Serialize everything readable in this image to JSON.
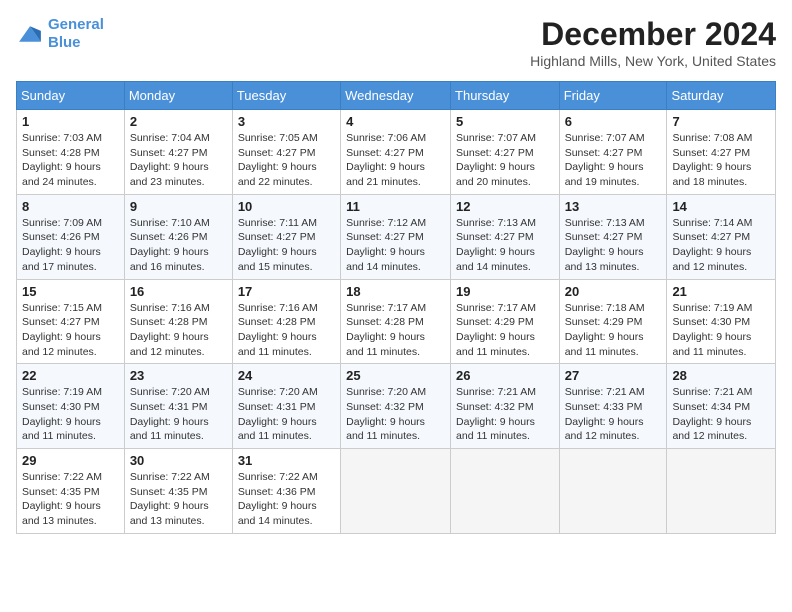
{
  "header": {
    "logo_line1": "General",
    "logo_line2": "Blue",
    "month": "December 2024",
    "location": "Highland Mills, New York, United States"
  },
  "days_of_week": [
    "Sunday",
    "Monday",
    "Tuesday",
    "Wednesday",
    "Thursday",
    "Friday",
    "Saturday"
  ],
  "weeks": [
    [
      {
        "num": "1",
        "sunrise": "7:03 AM",
        "sunset": "4:28 PM",
        "daylight": "9 hours and 24 minutes."
      },
      {
        "num": "2",
        "sunrise": "7:04 AM",
        "sunset": "4:27 PM",
        "daylight": "9 hours and 23 minutes."
      },
      {
        "num": "3",
        "sunrise": "7:05 AM",
        "sunset": "4:27 PM",
        "daylight": "9 hours and 22 minutes."
      },
      {
        "num": "4",
        "sunrise": "7:06 AM",
        "sunset": "4:27 PM",
        "daylight": "9 hours and 21 minutes."
      },
      {
        "num": "5",
        "sunrise": "7:07 AM",
        "sunset": "4:27 PM",
        "daylight": "9 hours and 20 minutes."
      },
      {
        "num": "6",
        "sunrise": "7:07 AM",
        "sunset": "4:27 PM",
        "daylight": "9 hours and 19 minutes."
      },
      {
        "num": "7",
        "sunrise": "7:08 AM",
        "sunset": "4:27 PM",
        "daylight": "9 hours and 18 minutes."
      }
    ],
    [
      {
        "num": "8",
        "sunrise": "7:09 AM",
        "sunset": "4:26 PM",
        "daylight": "9 hours and 17 minutes."
      },
      {
        "num": "9",
        "sunrise": "7:10 AM",
        "sunset": "4:26 PM",
        "daylight": "9 hours and 16 minutes."
      },
      {
        "num": "10",
        "sunrise": "7:11 AM",
        "sunset": "4:27 PM",
        "daylight": "9 hours and 15 minutes."
      },
      {
        "num": "11",
        "sunrise": "7:12 AM",
        "sunset": "4:27 PM",
        "daylight": "9 hours and 14 minutes."
      },
      {
        "num": "12",
        "sunrise": "7:13 AM",
        "sunset": "4:27 PM",
        "daylight": "9 hours and 14 minutes."
      },
      {
        "num": "13",
        "sunrise": "7:13 AM",
        "sunset": "4:27 PM",
        "daylight": "9 hours and 13 minutes."
      },
      {
        "num": "14",
        "sunrise": "7:14 AM",
        "sunset": "4:27 PM",
        "daylight": "9 hours and 12 minutes."
      }
    ],
    [
      {
        "num": "15",
        "sunrise": "7:15 AM",
        "sunset": "4:27 PM",
        "daylight": "9 hours and 12 minutes."
      },
      {
        "num": "16",
        "sunrise": "7:16 AM",
        "sunset": "4:28 PM",
        "daylight": "9 hours and 12 minutes."
      },
      {
        "num": "17",
        "sunrise": "7:16 AM",
        "sunset": "4:28 PM",
        "daylight": "9 hours and 11 minutes."
      },
      {
        "num": "18",
        "sunrise": "7:17 AM",
        "sunset": "4:28 PM",
        "daylight": "9 hours and 11 minutes."
      },
      {
        "num": "19",
        "sunrise": "7:17 AM",
        "sunset": "4:29 PM",
        "daylight": "9 hours and 11 minutes."
      },
      {
        "num": "20",
        "sunrise": "7:18 AM",
        "sunset": "4:29 PM",
        "daylight": "9 hours and 11 minutes."
      },
      {
        "num": "21",
        "sunrise": "7:19 AM",
        "sunset": "4:30 PM",
        "daylight": "9 hours and 11 minutes."
      }
    ],
    [
      {
        "num": "22",
        "sunrise": "7:19 AM",
        "sunset": "4:30 PM",
        "daylight": "9 hours and 11 minutes."
      },
      {
        "num": "23",
        "sunrise": "7:20 AM",
        "sunset": "4:31 PM",
        "daylight": "9 hours and 11 minutes."
      },
      {
        "num": "24",
        "sunrise": "7:20 AM",
        "sunset": "4:31 PM",
        "daylight": "9 hours and 11 minutes."
      },
      {
        "num": "25",
        "sunrise": "7:20 AM",
        "sunset": "4:32 PM",
        "daylight": "9 hours and 11 minutes."
      },
      {
        "num": "26",
        "sunrise": "7:21 AM",
        "sunset": "4:32 PM",
        "daylight": "9 hours and 11 minutes."
      },
      {
        "num": "27",
        "sunrise": "7:21 AM",
        "sunset": "4:33 PM",
        "daylight": "9 hours and 12 minutes."
      },
      {
        "num": "28",
        "sunrise": "7:21 AM",
        "sunset": "4:34 PM",
        "daylight": "9 hours and 12 minutes."
      }
    ],
    [
      {
        "num": "29",
        "sunrise": "7:22 AM",
        "sunset": "4:35 PM",
        "daylight": "9 hours and 13 minutes."
      },
      {
        "num": "30",
        "sunrise": "7:22 AM",
        "sunset": "4:35 PM",
        "daylight": "9 hours and 13 minutes."
      },
      {
        "num": "31",
        "sunrise": "7:22 AM",
        "sunset": "4:36 PM",
        "daylight": "9 hours and 14 minutes."
      },
      null,
      null,
      null,
      null
    ]
  ]
}
